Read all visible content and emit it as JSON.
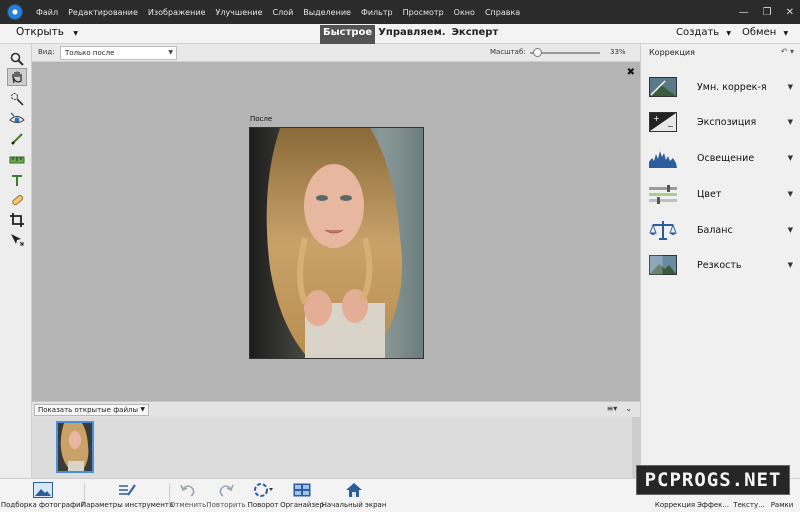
{
  "menu": {
    "items": [
      "Файл",
      "Редактирование",
      "Изображение",
      "Улучшение",
      "Слой",
      "Выделение",
      "Фильтр",
      "Просмотр",
      "Окно",
      "Справка"
    ]
  },
  "window_controls": {
    "minimize": "—",
    "maximize": "❐",
    "close": "✕"
  },
  "modebar": {
    "open_label": "Открыть",
    "modes": [
      {
        "label": "Быстрое",
        "active": true
      },
      {
        "label": "Управляем.",
        "active": false
      },
      {
        "label": "Эксперт",
        "active": false
      }
    ],
    "create_label": "Создать",
    "share_label": "Обмен"
  },
  "options": {
    "view_label": "Вид:",
    "view_value": "Только после",
    "zoom_label": "Масштаб:",
    "zoom_value": "33%",
    "zoom_slider_fraction": 0.1
  },
  "tools": [
    "zoom-icon",
    "hand-icon",
    "quick-selection-icon",
    "red-eye-icon",
    "whiten-teeth-icon",
    "straighten-icon",
    "text-icon",
    "spot-healing-icon",
    "crop-icon",
    "move-icon"
  ],
  "canvas": {
    "after_label": "После",
    "close": "✖"
  },
  "bin": {
    "select_value": "Показать открытые файлы"
  },
  "panel": {
    "title": "Коррекция",
    "close": "✖",
    "adjustments": [
      {
        "label": "Умн. коррек-я",
        "icon": "smart-fix-icon"
      },
      {
        "label": "Экспозиция",
        "icon": "exposure-icon"
      },
      {
        "label": "Освещение",
        "icon": "lighting-icon"
      },
      {
        "label": "Цвет",
        "icon": "color-icon"
      },
      {
        "label": "Баланс",
        "icon": "balance-icon"
      },
      {
        "label": "Резкость",
        "icon": "sharpness-icon"
      }
    ]
  },
  "bottom": {
    "photo_bin": "Подборка фотографий",
    "tool_options": "Параметры инструмента",
    "undo": "Отменить",
    "redo": "Повторить",
    "rotate": "Поворот",
    "organizer": "Органайзер",
    "home": "Начальный экран",
    "adjustments": "Коррекция",
    "effects": "Эффек...",
    "textures": "Тексту...",
    "frames": "Рамки"
  },
  "watermark": "PCPROGS.NET",
  "colors": {
    "menubar_bg": "#2b2b2b",
    "canvas_bg": "#b4b4b4",
    "active_mode_bg": "#535353",
    "accent_blue": "#4a90d9"
  }
}
